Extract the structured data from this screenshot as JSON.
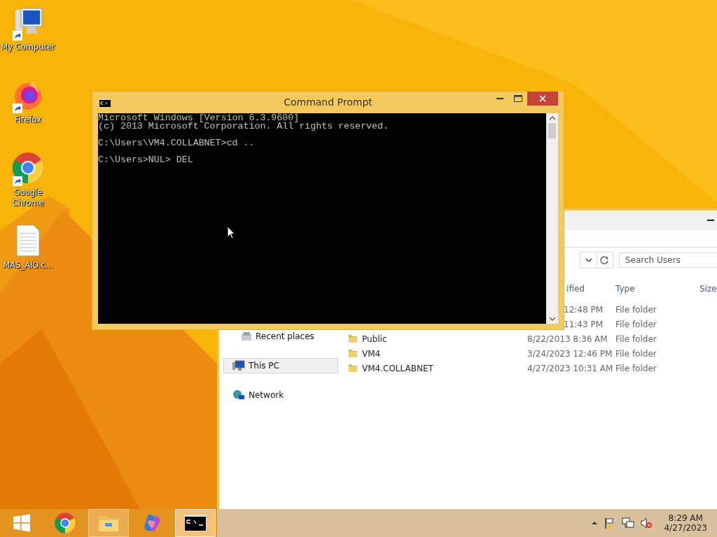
{
  "desktop": {
    "icons": [
      {
        "kind": "computer",
        "label": "My Computer",
        "shortcut": true
      },
      {
        "kind": "firefox",
        "label": "Firefox",
        "shortcut": true
      },
      {
        "kind": "chrome",
        "label": "Google Chrome",
        "shortcut": true
      },
      {
        "kind": "document",
        "label": "MAS_AIO.c...",
        "shortcut": false
      }
    ]
  },
  "explorer": {
    "search": {
      "placeholder": "Search Users"
    },
    "columns": [
      {
        "kind": "date",
        "label": "ified"
      },
      {
        "kind": "type",
        "label": "Type"
      },
      {
        "kind": "size",
        "label": "Size"
      }
    ],
    "nav": [
      {
        "kind": "recent",
        "label": "Recent places",
        "selected": false
      },
      {
        "kind": "pc",
        "label": "This PC",
        "selected": true
      },
      {
        "kind": "network",
        "label": "Network",
        "selected": false
      }
    ],
    "rows": [
      {
        "date": "12:48 PM",
        "type": "File folder"
      },
      {
        "date": "11:43 PM",
        "type": "File folder"
      },
      {
        "name": "Public",
        "date": "8/22/2013 8:36 AM",
        "type": "File folder"
      },
      {
        "name": "VM4",
        "date": "3/24/2023 12:46 PM",
        "type": "File folder"
      },
      {
        "name": "VM4.COLLABNET",
        "date": "4/27/2023 10:31 AM",
        "type": "File folder"
      }
    ]
  },
  "console": {
    "title": "Command Prompt",
    "blocks": [
      [
        "Microsoft Windows [Version 6.3.9600]",
        "(c) 2013 Microsoft Corporation. All rights reserved."
      ],
      [
        "C:\\Users\\VM4.COLLABNET>cd .."
      ],
      [
        "C:\\Users>NUL> DEL"
      ]
    ]
  },
  "taskbar": {
    "apps": [
      {
        "kind": "start",
        "running": false,
        "selected": false
      },
      {
        "kind": "chrome",
        "running": false,
        "selected": false
      },
      {
        "kind": "explorer",
        "running": true,
        "selected": false
      },
      {
        "kind": "copilot",
        "running": false,
        "selected": false
      },
      {
        "kind": "cmd",
        "running": true,
        "selected": true
      }
    ],
    "tray": {
      "time": "8:29 AM",
      "date": "4/27/2023"
    }
  }
}
